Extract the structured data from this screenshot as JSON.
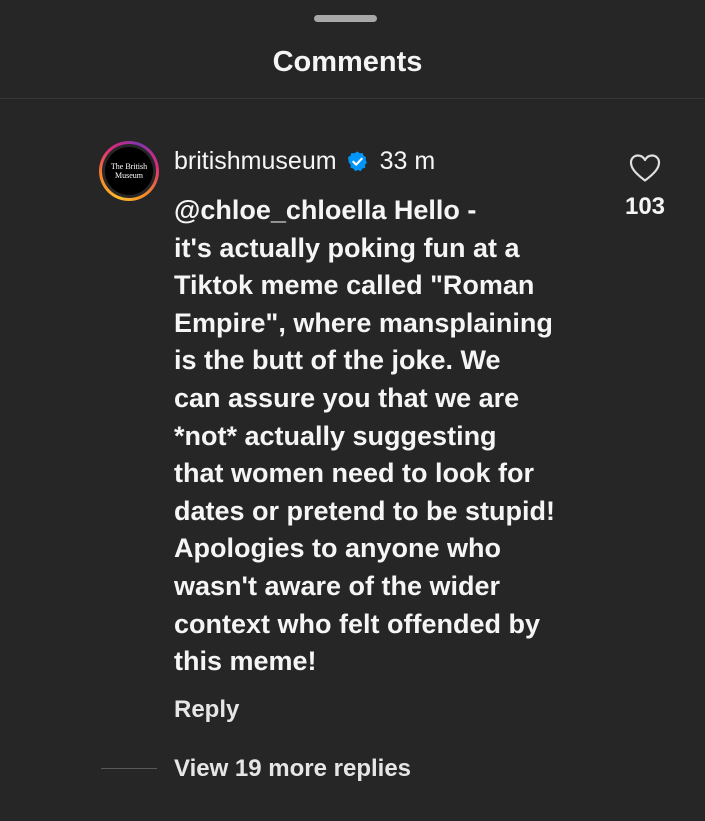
{
  "header": {
    "title": "Comments"
  },
  "comment": {
    "avatar_text": [
      "The British",
      "Museum"
    ],
    "username": "britishmuseum",
    "verified": true,
    "time": "33 m",
    "like_count": "103",
    "text_lines": [
      "@chloe_chloella Hello -",
      "it's actually poking fun at a",
      "Tiktok meme called \"Roman",
      "Empire\", where mansplaining",
      "is the butt of the joke. We",
      "can assure you that we are",
      "*not* actually suggesting",
      "that women need to look for",
      "dates or pretend to be stupid!",
      "Apologies to anyone who",
      "wasn't aware of the wider",
      "context who felt offended by",
      "this meme!"
    ],
    "reply_label": "Reply",
    "view_replies_label": "View 19 more replies"
  },
  "icons": {
    "verified": "verified-badge-icon",
    "like": "heart-outline-icon"
  },
  "colors": {
    "background": "#262626",
    "text": "#f5f5f5",
    "verified_blue": "#0095f6"
  }
}
